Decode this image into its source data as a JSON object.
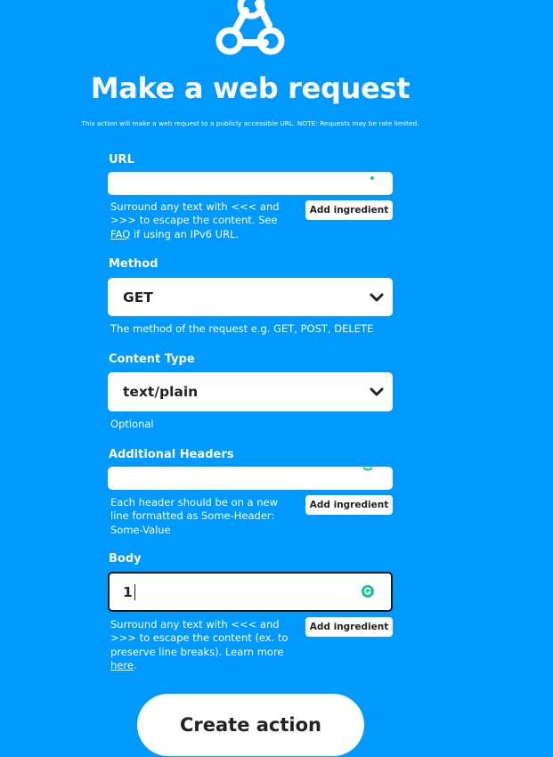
{
  "header": {
    "logo_icon": "webhook-icon",
    "title": "Make a web request",
    "subtitle": "This action will make a web request to a publicly accessible URL. NOTE: Requests may be rate limited."
  },
  "url": {
    "label": "URL",
    "value": "",
    "help_part1": "Surround any text with <<< and >>> to escape the content. See",
    "help_link": "FAQ",
    "help_part2": "if using an IPv6 URL.",
    "ingredient_label": "Add ingredient"
  },
  "method": {
    "label": "Method",
    "value": "GET",
    "help": "The method of the request e.g. GET, POST, DELETE"
  },
  "content_type": {
    "label": "Content Type",
    "value": "text/plain",
    "help": "Optional"
  },
  "headers": {
    "label": "Additional Headers",
    "value": "",
    "help": "Each header should be on a new line formatted as Some-Header: Some-Value",
    "ingredient_label": "Add ingredient"
  },
  "body": {
    "label": "Body",
    "value": "1",
    "help_part1": "Surround any text with <<< and >>> to escape the content (ex. to preserve line breaks). Learn more",
    "help_link": "here",
    "help_part2": ".",
    "ingredient_label": "Add ingredient"
  },
  "create_button": "Create action",
  "colors": {
    "background": "#0099ff",
    "grammarly": "#15c39a"
  }
}
